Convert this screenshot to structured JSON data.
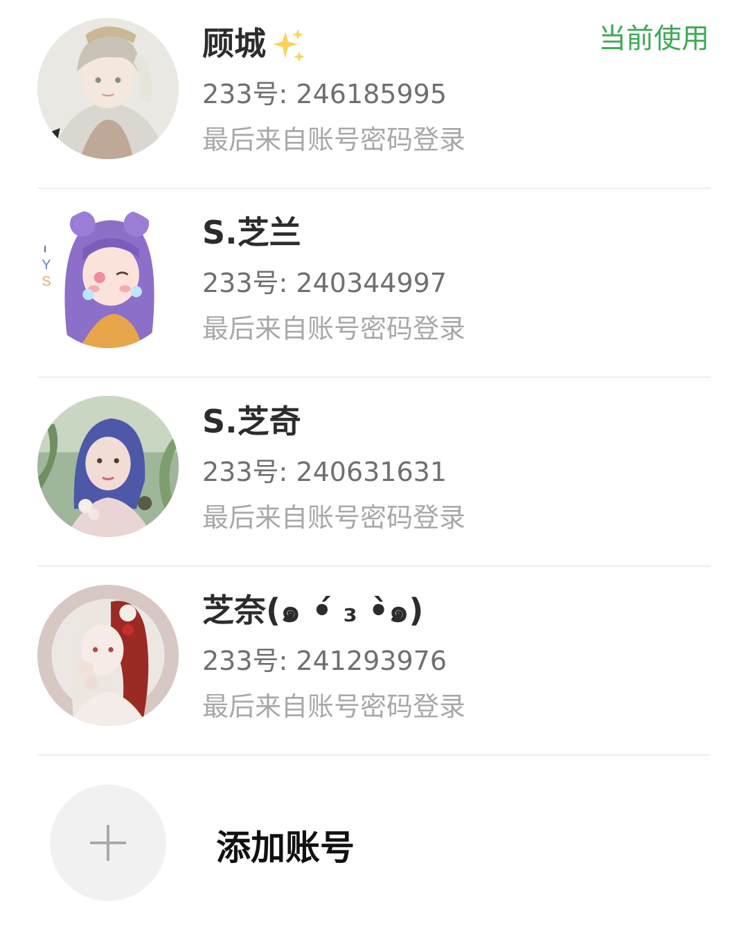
{
  "accounts": [
    {
      "name": "顾城",
      "id_text": "233号: 246185995",
      "login_text": "最后来自账号密码登录",
      "status": "当前使用"
    },
    {
      "name": "S.芝兰",
      "id_text": "233号: 240344997",
      "login_text": "最后来自账号密码登录"
    },
    {
      "name": "S.芝奇",
      "id_text": "233号: 240631631",
      "login_text": "最后来自账号密码登录"
    },
    {
      "name": "芝奈(๑ •́ ₃ •̀๑)",
      "id_text": "233号: 241293976",
      "login_text": "最后来自账号密码登录"
    }
  ],
  "add_account": {
    "label": "添加账号"
  },
  "colors": {
    "status_green": "#3daa54",
    "name_text": "#2c2c2c",
    "id_text": "#6f6f6f",
    "login_text": "#a8a8a8",
    "divider": "#eeeeee"
  }
}
